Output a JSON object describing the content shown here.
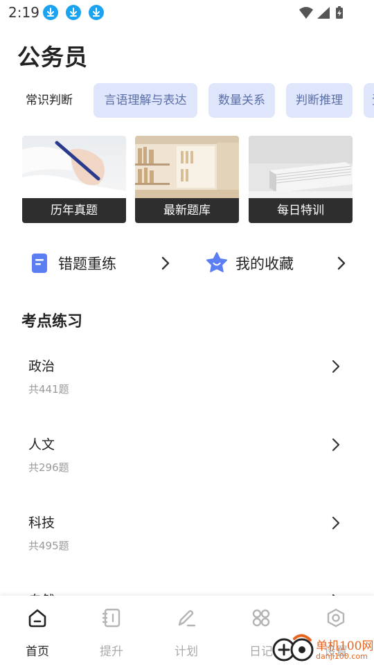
{
  "status_bar": {
    "time": "2:19"
  },
  "page": {
    "title": "公务员"
  },
  "tabs": [
    {
      "label": "常识判断",
      "active": true
    },
    {
      "label": "言语理解与表达",
      "active": false
    },
    {
      "label": "数量关系",
      "active": false
    },
    {
      "label": "判断推理",
      "active": false
    },
    {
      "label": "资",
      "active": false
    }
  ],
  "cards": [
    {
      "label": "历年真题"
    },
    {
      "label": "最新题库"
    },
    {
      "label": "每日特训"
    }
  ],
  "quick_links": [
    {
      "label": "错题重练",
      "icon": "document-icon"
    },
    {
      "label": "我的收藏",
      "icon": "star-icon"
    }
  ],
  "section": {
    "title": "考点练习"
  },
  "topics": [
    {
      "name": "政治",
      "count": "共441题"
    },
    {
      "name": "人文",
      "count": "共296题"
    },
    {
      "name": "科技",
      "count": "共495题"
    },
    {
      "name": "自然",
      "count": ""
    }
  ],
  "nav": [
    {
      "label": "首页",
      "icon": "home-icon",
      "active": true
    },
    {
      "label": "提升",
      "icon": "notebook-icon",
      "active": false
    },
    {
      "label": "计划",
      "icon": "edit-icon",
      "active": false
    },
    {
      "label": "日记",
      "icon": "apps-icon",
      "active": false
    },
    {
      "label": "设置",
      "icon": "settings-icon",
      "active": false
    }
  ],
  "watermark": {
    "text": "单机100网",
    "sub": "danji100.com"
  },
  "colors": {
    "tab_bg": "#dfe6fb",
    "tab_text": "#5a6ea8",
    "accent": "#4f7cf0",
    "download": "#1aa3f0"
  }
}
